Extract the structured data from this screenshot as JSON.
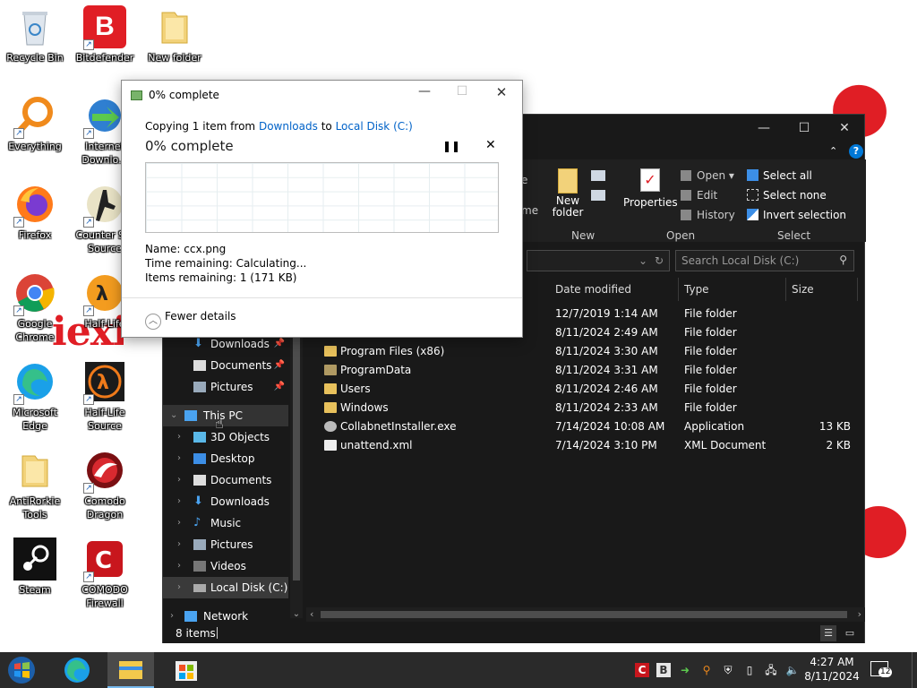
{
  "desktop": {
    "icons": [
      {
        "label": "Recycle Bin",
        "icon": "recycle-bin-icon"
      },
      {
        "label": "Bitdefender",
        "icon": "bitdefender-icon"
      },
      {
        "label": "New folder",
        "icon": "folder-icon"
      },
      {
        "label": "Everything",
        "icon": "everything-search-icon"
      },
      {
        "label": "Internet Downlo...",
        "icon": "internet-download-manager-icon"
      },
      {
        "label": "Firefox",
        "icon": "firefox-icon"
      },
      {
        "label": "Counter S... Source",
        "icon": "counter-strike-icon"
      },
      {
        "label": "Google Chrome",
        "icon": "chrome-icon"
      },
      {
        "label": "Half-Life",
        "icon": "half-life-icon"
      },
      {
        "label": "Microsoft Edge",
        "icon": "edge-icon"
      },
      {
        "label": "Half-Life Source",
        "icon": "half-life-source-icon"
      },
      {
        "label": "AntiRorkie Tools",
        "icon": "folder-icon"
      },
      {
        "label": "Comodo Dragon",
        "icon": "comodo-dragon-icon"
      },
      {
        "label": "Steam",
        "icon": "steam-icon"
      },
      {
        "label": "COMODO Firewall",
        "icon": "comodo-firewall-icon"
      }
    ],
    "wallpaper_text": "iexis"
  },
  "copy_dialog": {
    "title": "0% complete",
    "copy_prefix": "Copying 1 item from",
    "source": "Downloads",
    "to_word": "to",
    "destination": "Local Disk (C:)",
    "heading": "0% complete",
    "progress": 0,
    "name_label": "Name:",
    "name_value": "ccx.png",
    "time_label": "Time remaining:",
    "time_value": "Calculating...",
    "items_label": "Items remaining:",
    "items_value": "1 (171 KB)",
    "fewer_details": "Fewer details",
    "pause_icon": "pause-icon",
    "cancel_icon": "close-icon"
  },
  "explorer": {
    "ribbon": {
      "new_folder": "New folder",
      "new_group": "New",
      "properties": "Properties",
      "open": "Open",
      "edit": "Edit",
      "history": "History",
      "open_group": "Open",
      "select_all": "Select all",
      "select_none": "Select none",
      "invert_selection": "Invert selection",
      "select_group": "Select",
      "partial_1": "e",
      "partial_2": "me"
    },
    "search_placeholder": "Search Local Disk (C:)",
    "columns": {
      "date": "Date modified",
      "type": "Type",
      "size": "Size"
    },
    "files": [
      {
        "name": "",
        "date": "12/7/2019 1:14 AM",
        "type": "File folder",
        "size": ""
      },
      {
        "name": "",
        "date": "8/11/2024 2:49 AM",
        "type": "File folder",
        "size": ""
      },
      {
        "name": "Program Files (x86)",
        "date": "8/11/2024 3:30 AM",
        "type": "File folder",
        "size": ""
      },
      {
        "name": "ProgramData",
        "date": "8/11/2024 3:31 AM",
        "type": "File folder",
        "size": ""
      },
      {
        "name": "Users",
        "date": "8/11/2024 2:46 AM",
        "type": "File folder",
        "size": ""
      },
      {
        "name": "Windows",
        "date": "8/11/2024 2:33 AM",
        "type": "File folder",
        "size": ""
      },
      {
        "name": "CollabnetInstaller.exe",
        "date": "7/14/2024 10:08 AM",
        "type": "Application",
        "size": "13 KB"
      },
      {
        "name": "unattend.xml",
        "date": "7/14/2024 3:10 PM",
        "type": "XML Document",
        "size": "2 KB"
      }
    ],
    "nav_quick": [
      {
        "label": "Downloads",
        "icon": "download-arrow-icon"
      },
      {
        "label": "Documents",
        "icon": "document-icon"
      },
      {
        "label": "Pictures",
        "icon": "pictures-icon"
      }
    ],
    "nav_this_pc": "This PC",
    "nav_pc_items": [
      {
        "label": "3D Objects",
        "icon": "3d-objects-icon"
      },
      {
        "label": "Desktop",
        "icon": "desktop-icon"
      },
      {
        "label": "Documents",
        "icon": "document-icon"
      },
      {
        "label": "Downloads",
        "icon": "download-arrow-icon"
      },
      {
        "label": "Music",
        "icon": "music-icon"
      },
      {
        "label": "Pictures",
        "icon": "pictures-icon"
      },
      {
        "label": "Videos",
        "icon": "videos-icon"
      },
      {
        "label": "Local Disk (C:)",
        "icon": "drive-icon"
      }
    ],
    "nav_network": "Network",
    "status": "8 items"
  },
  "taskbar": {
    "time": "4:27 AM",
    "date": "8/11/2024",
    "notification_count": "12"
  },
  "colors": {
    "accent": "#0078d7",
    "brand_red": "#e01e25",
    "taskbar": "#2a2a2a",
    "explorer_bg": "#191919"
  }
}
